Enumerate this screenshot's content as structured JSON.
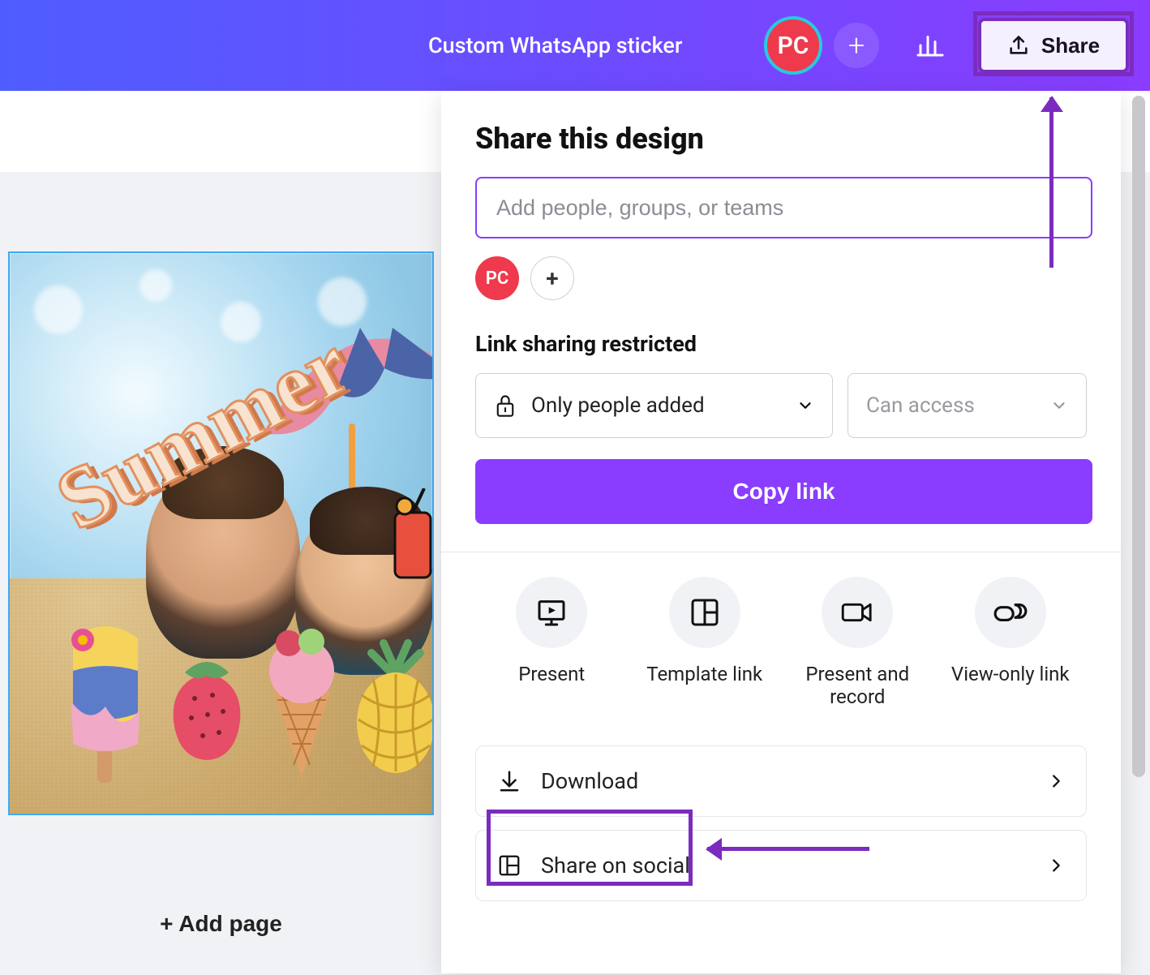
{
  "header": {
    "title": "Custom WhatsApp sticker",
    "avatar_initials": "PC",
    "share_label": "Share"
  },
  "canvas": {
    "summer_text": "Summer",
    "add_page_label": "+ Add page"
  },
  "share_panel": {
    "title": "Share this design",
    "people_placeholder": "Add people, groups, or teams",
    "avatar_initials": "PC",
    "link_sharing_label": "Link sharing restricted",
    "permission_select": "Only people added",
    "access_select": "Can access",
    "copy_link_label": "Copy link",
    "actions": [
      {
        "label": "Present",
        "icon": "present"
      },
      {
        "label": "Template link",
        "icon": "template"
      },
      {
        "label": "Present and record",
        "icon": "record"
      },
      {
        "label": "View-only link",
        "icon": "link"
      }
    ],
    "list": [
      {
        "label": "Download",
        "icon": "download"
      },
      {
        "label": "Share on social",
        "icon": "social"
      }
    ]
  }
}
